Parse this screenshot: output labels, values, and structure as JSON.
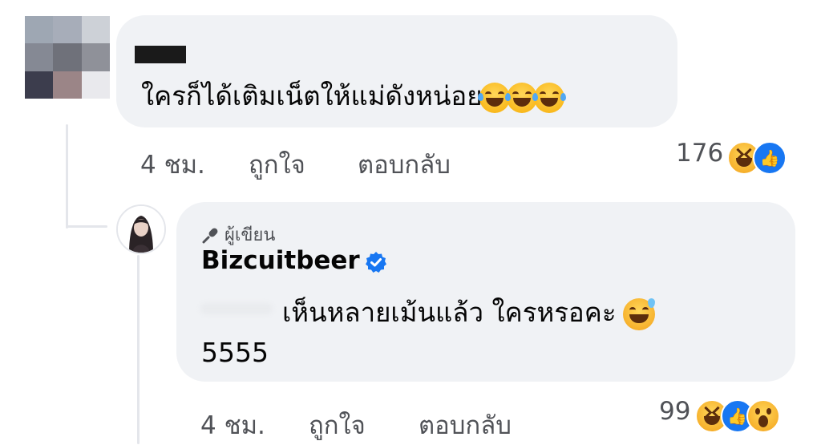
{
  "comment1": {
    "text": "ใครก็ได้เติมเน็ตให้แม่ดังหน่อย",
    "emoji": [
      "rolling-on-floor-laughing",
      "rolling-on-floor-laughing",
      "rolling-on-floor-laughing"
    ],
    "time": "4 ชม.",
    "like_label": "ถูกใจ",
    "reply_label": "ตอบกลับ",
    "reaction_count": "176",
    "reactions": [
      "haha",
      "like"
    ]
  },
  "reply": {
    "badge_icon": "microphone-icon",
    "badge_label": "ผู้เขียน",
    "author": "Bizcuitbeer",
    "verified": true,
    "text_line1": "เห็นหลายเม้นแล้ว ใครหรอคะ",
    "text_line2": "5555",
    "emoji": "grinning-face-with-sweat",
    "time": "4 ชม.",
    "like_label": "ถูกใจ",
    "reply_label": "ตอบกลับ",
    "reaction_count": "99",
    "reactions": [
      "haha",
      "like",
      "wow"
    ]
  },
  "colors": {
    "bubble": "#f0f2f5",
    "meta_text": "#505257",
    "verified": "#1877f2",
    "like": "#1877f2"
  }
}
